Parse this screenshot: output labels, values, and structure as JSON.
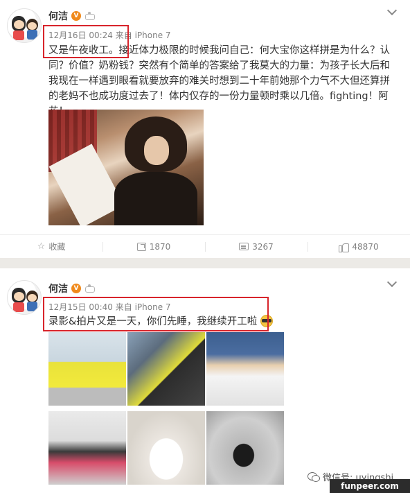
{
  "posts": [
    {
      "username": "何洁",
      "verified_badge": "V",
      "meta": "12月16日 00:24 来自 iPhone 7",
      "text": "又是午夜收工。接近体力极限的时候我问自己：何大宝你这样拼是为什么？认同？价值？奶粉钱？突然有个简单的答案给了我莫大的力量：为孩子长大后和我现在一样遇到眼看就要放弃的难关时想到二十年前她那个力气不大但还算拼的老妈不也成功度过去了！体内仅存的一份力量顿时乘以几倍。fighting！阿花！",
      "actions": {
        "favorite": "收藏",
        "reposts": "1870",
        "comments": "3267",
        "likes": "48870"
      }
    },
    {
      "username": "何洁",
      "verified_badge": "V",
      "meta": "12月15日 00:40 来自 iPhone 7",
      "text": "录影&拍片又是一天，你们先睡，我继续开工啦"
    }
  ],
  "icons": {
    "star": "☆"
  },
  "watermark": {
    "wechat": "微信号: uyingshi",
    "site": "funpeer.com"
  },
  "colors": {
    "highlight_box": "#d8242b",
    "verified": "#f08a1c"
  }
}
